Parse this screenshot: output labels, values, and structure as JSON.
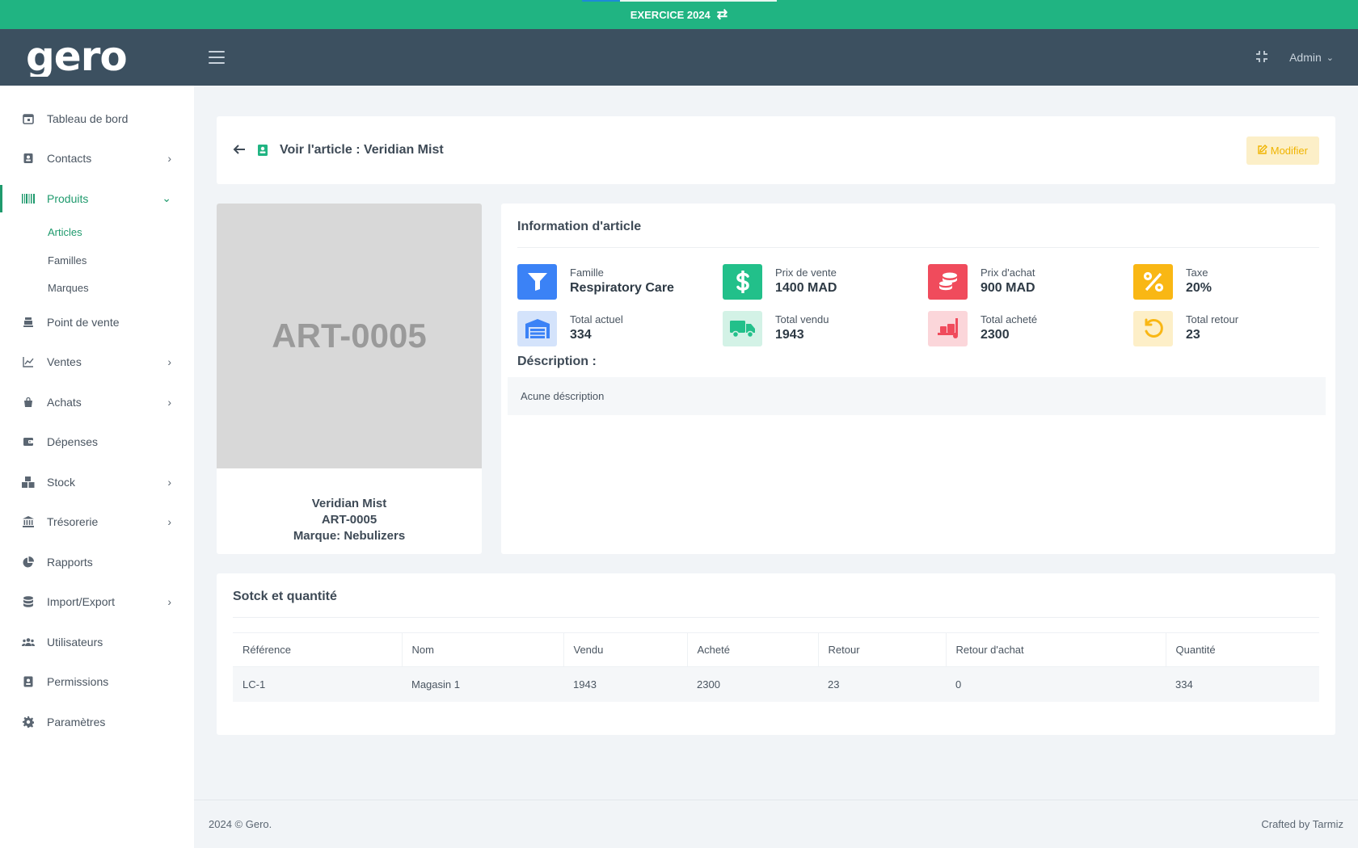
{
  "banner": {
    "exercise_label": "EXERCICE 2024",
    "swap_icon": "swap-arrows-icon"
  },
  "header": {
    "logo_text": "gero",
    "user_label": "Admin"
  },
  "sidebar": {
    "items": [
      {
        "label": "Tableau de bord",
        "icon": "calendar-icon"
      },
      {
        "label": "Contacts",
        "icon": "contact-card-icon"
      },
      {
        "label": "Produits",
        "icon": "barcode-icon"
      },
      {
        "label": "Point de vente",
        "icon": "register-icon"
      },
      {
        "label": "Ventes",
        "icon": "chart-line-icon"
      },
      {
        "label": "Achats",
        "icon": "shopping-bag-icon"
      },
      {
        "label": "Dépenses",
        "icon": "wallet-icon"
      },
      {
        "label": "Stock",
        "icon": "boxes-icon"
      },
      {
        "label": "Trésorerie",
        "icon": "bank-icon"
      },
      {
        "label": "Rapports",
        "icon": "pie-chart-icon"
      },
      {
        "label": "Import/Export",
        "icon": "database-icon"
      },
      {
        "label": "Utilisateurs",
        "icon": "users-icon"
      },
      {
        "label": "Permissions",
        "icon": "id-badge-icon"
      },
      {
        "label": "Paramètres",
        "icon": "gear-icon"
      }
    ],
    "sub_items": [
      {
        "label": "Articles"
      },
      {
        "label": "Familles"
      },
      {
        "label": "Marques"
      }
    ]
  },
  "page": {
    "title": "Voir l'article : Veridian Mist",
    "modify_label": "Modifier"
  },
  "article": {
    "placeholder_code": "ART-0005",
    "name": "Veridian Mist",
    "code": "ART-0005",
    "brand_line": "Marque: Nebulizers"
  },
  "info": {
    "title": "Information d'article",
    "stats": [
      {
        "label": "Famille",
        "value": "Respiratory Care",
        "icon": "filter-icon",
        "bg": "#3b82f6",
        "fg": "#ffffff"
      },
      {
        "label": "Prix de vente",
        "value": "1400 MAD",
        "icon": "dollar-icon",
        "bg": "#22c08a",
        "fg": "#ffffff"
      },
      {
        "label": "Prix d'achat",
        "value": "900 MAD",
        "icon": "coins-icon",
        "bg": "#f04b5c",
        "fg": "#ffffff"
      },
      {
        "label": "Taxe",
        "value": "20%",
        "icon": "percent-icon",
        "bg": "#f9b714",
        "fg": "#ffffff"
      },
      {
        "label": "Total actuel",
        "value": "334",
        "icon": "warehouse-icon",
        "bg": "#d4e3fb",
        "fg": "#3b82f6"
      },
      {
        "label": "Total vendu",
        "value": "1943",
        "icon": "truck-icon",
        "bg": "#d3f2e6",
        "fg": "#22c08a"
      },
      {
        "label": "Total acheté",
        "value": "2300",
        "icon": "dolly-icon",
        "bg": "#fbd6da",
        "fg": "#f04b5c"
      },
      {
        "label": "Total retour",
        "value": "23",
        "icon": "undo-icon",
        "bg": "#fdefc8",
        "fg": "#f9b714"
      }
    ],
    "description_label": "Déscription :",
    "description_text": "Acune déscription"
  },
  "stock": {
    "title": "Sotck et quantité",
    "columns": [
      "Référence",
      "Nom",
      "Vendu",
      "Acheté",
      "Retour",
      "Retour d'achat",
      "Quantité"
    ],
    "rows": [
      [
        "LC-1",
        "Magasin 1",
        "1943",
        "2300",
        "23",
        "0",
        "334"
      ]
    ]
  },
  "footer": {
    "left": "2024 © Gero.",
    "right": "Crafted by Tarmiz"
  }
}
